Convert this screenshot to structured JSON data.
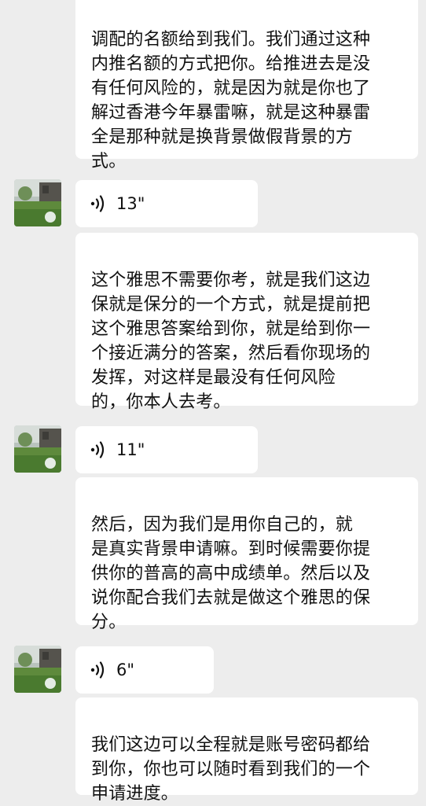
{
  "messages": [
    {
      "type": "text",
      "text": "调配的名额给到我们。我们通过这种\n内推名额的方式把你。给推进去是没\n有任何风险的，就是因为就是你也了\n解过香港今年暴雷嘛，就是这种暴雷\n全是那种就是换背景做假背景的方\n式。"
    },
    {
      "type": "voice",
      "duration": "13\""
    },
    {
      "type": "text",
      "text": "这个雅思不需要你考，就是我们这边\n保就是保分的一个方式，就是提前把\n这个雅思答案给到你，就是给到你一\n个接近满分的答案，然后看你现场的\n发挥，对这样是最没有任何风险\n的，你本人去考。"
    },
    {
      "type": "voice",
      "duration": "11\""
    },
    {
      "type": "text",
      "text": "然后，因为我们是用你自己的，就\n是真实背景申请嘛。到时候需要你提\n供你的普高的高中成绩单。然后以及\n说你配合我们去就是做这个雅思的保\n分。"
    },
    {
      "type": "voice",
      "duration": "6\""
    },
    {
      "type": "text",
      "text": "我们这边可以全程就是账号密码都给\n到你，你也可以随时看到我们的一个\n申请进度。"
    }
  ],
  "colors": {
    "background": "#ededed",
    "bubble": "#ffffff",
    "text": "#111111"
  },
  "icons": {
    "voice": "voice-wave-icon",
    "avatar": "contact-avatar"
  }
}
